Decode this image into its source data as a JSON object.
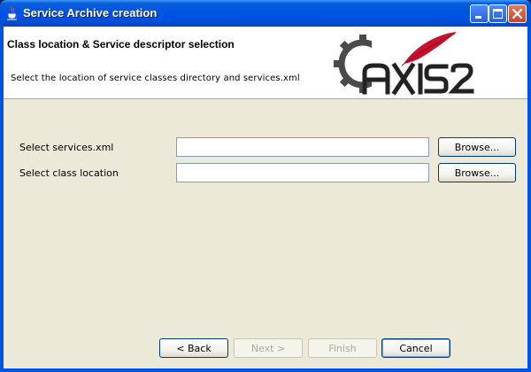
{
  "window": {
    "title": "Service Archive creation",
    "controls": {
      "minimize": "minimize",
      "maximize": "maximize",
      "close": "close"
    }
  },
  "header": {
    "title": "Class location & Service descriptor selection",
    "description": "Select the location of service classes directory and services.xml",
    "logo_text": "AXIS2"
  },
  "form": {
    "services_xml": {
      "label": "Select services.xml",
      "value": "",
      "browse_label": "Browse..."
    },
    "class_location": {
      "label": "Select class location",
      "value": "",
      "browse_label": "Browse..."
    }
  },
  "footer": {
    "back_label": "< Back",
    "next_label": "Next >",
    "finish_label": "Finish",
    "cancel_label": "Cancel"
  },
  "colors": {
    "titlebar": "#0054e3",
    "dialog_background": "#ece9d8",
    "field_border": "#7f9db9",
    "feather": "#c8102e"
  }
}
